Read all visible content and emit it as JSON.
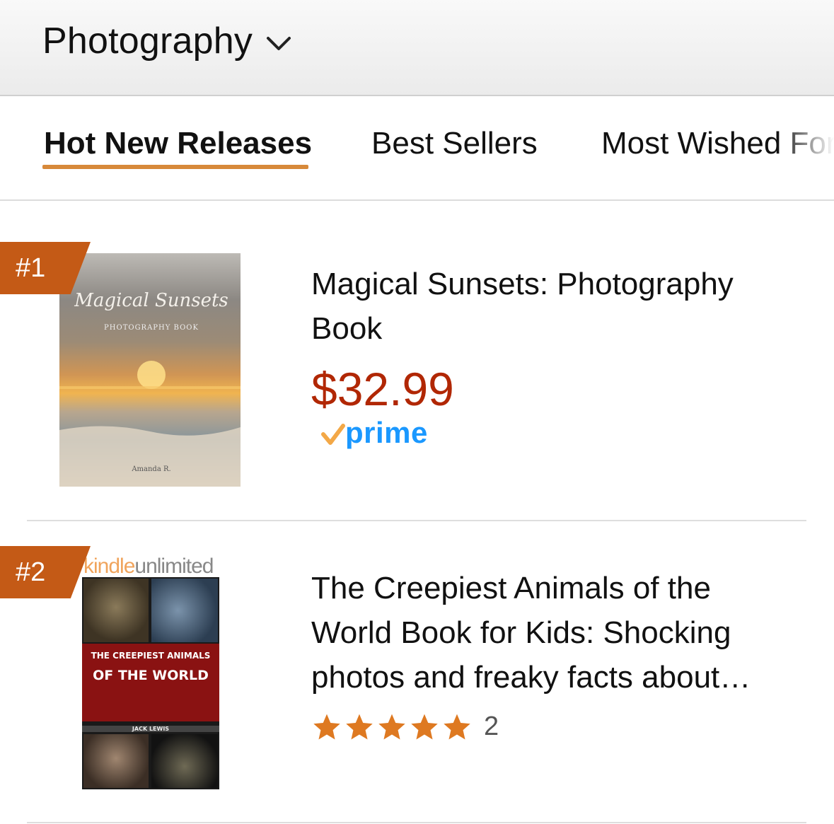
{
  "header": {
    "category": "Photography",
    "dropdown_icon": "chevron-down-icon"
  },
  "tabs": [
    {
      "label": "Hot New Releases",
      "active": true
    },
    {
      "label": "Best Sellers",
      "active": false
    },
    {
      "label": "Most Wished For",
      "active": false
    }
  ],
  "colors": {
    "accent": "#d7893a",
    "rank_badge": "#c45a16",
    "price": "#b12704",
    "prime_blue": "#1a98ff",
    "prime_check": "#f3a847",
    "star": "#de7921"
  },
  "items": [
    {
      "rank": "#1",
      "title": "Magical Sunsets: Photography Book",
      "price": "$32.99",
      "prime": "prime",
      "cover": {
        "title": "Magical Sunsets",
        "subtitle": "PHOTOGRAPHY BOOK",
        "author": "Amanda R."
      }
    },
    {
      "rank": "#2",
      "title": "The Creepiest Animals of the World Book for Kids: Shocking photos and freaky facts about…",
      "rating": 5,
      "rating_count": "2",
      "cover": {
        "badge_kindle": "kindle",
        "badge_unlimited": "unlimited",
        "title_line1": "THE CREEPIEST ANIMALS",
        "title_line2": "OF THE WORLD",
        "author": "JACK LEWIS"
      }
    }
  ]
}
